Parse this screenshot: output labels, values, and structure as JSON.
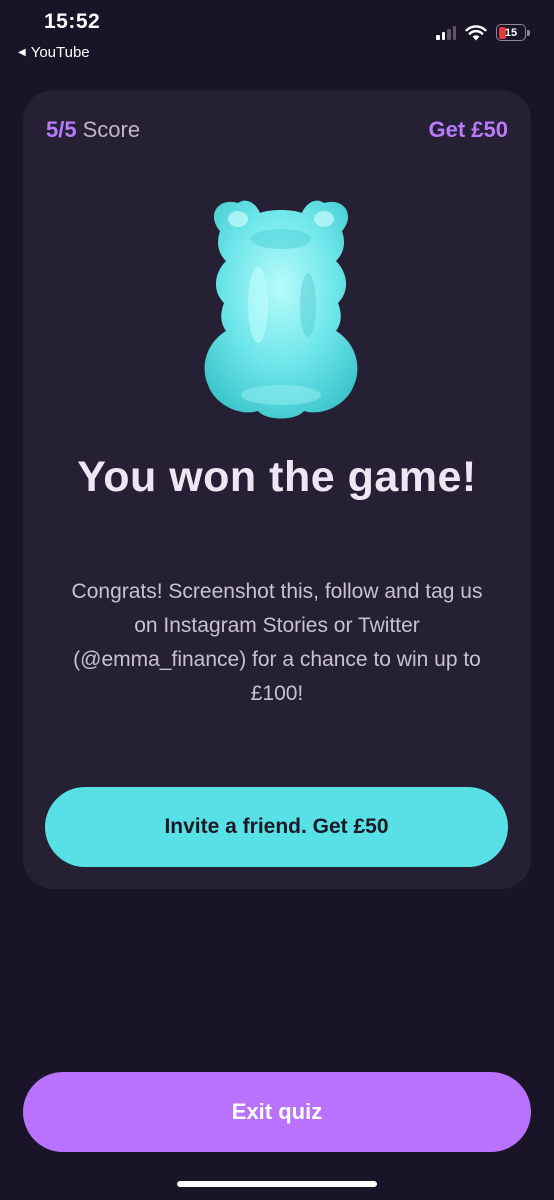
{
  "status_bar": {
    "time": "15:52",
    "back_app": "YouTube",
    "battery_level": "15",
    "battery_color": "#e5383b"
  },
  "card": {
    "score_value": "5/5",
    "score_label": "Score",
    "reward_link": "Get £50",
    "illustration": "gummy-bear-icon",
    "headline": "You won the game!",
    "body": "Congrats! Screenshot this, follow and tag us on Instagram Stories or Twitter (@emma_finance) for a chance to win up to £100!",
    "invite_button": "Invite a friend. Get £50"
  },
  "footer": {
    "exit_button": "Exit quiz"
  },
  "colors": {
    "background": "#1a1429",
    "card": "#252033",
    "accent_purple": "#b87bff",
    "accent_teal": "#57e1e6"
  }
}
